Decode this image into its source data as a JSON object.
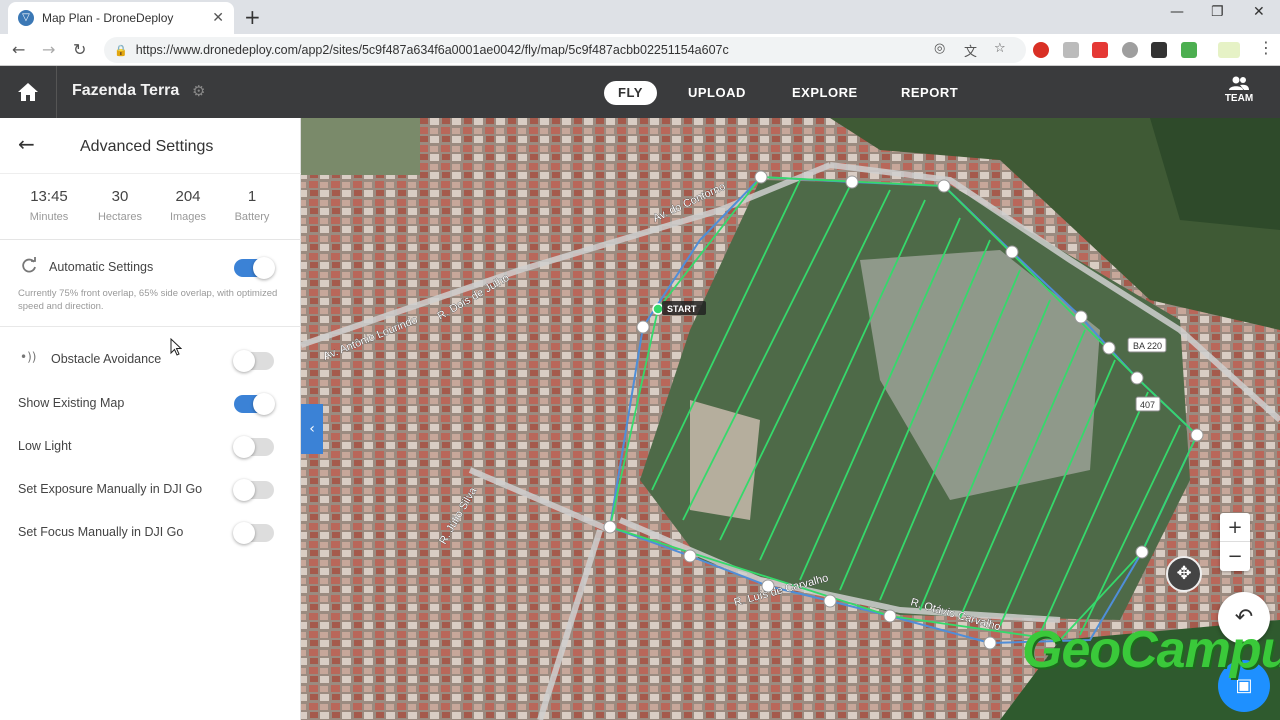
{
  "browser": {
    "tab_title": "Map Plan - DroneDeploy",
    "url": "https://www.dronedeploy.com/app2/sites/5c9f487a634f6a0001ae0042/fly/map/5c9f487acbb02251154a607c"
  },
  "header": {
    "site_name": "Fazenda Terra",
    "tabs": [
      {
        "label": "FLY",
        "active": true
      },
      {
        "label": "UPLOAD",
        "active": false
      },
      {
        "label": "EXPLORE",
        "active": false
      },
      {
        "label": "REPORT",
        "active": false
      }
    ],
    "team_label": "TEAM"
  },
  "panel": {
    "title": "Advanced Settings",
    "stats": [
      {
        "value": "13:45",
        "label": "Minutes"
      },
      {
        "value": "30",
        "label": "Hectares"
      },
      {
        "value": "204",
        "label": "Images"
      },
      {
        "value": "1",
        "label": "Battery"
      }
    ],
    "automatic": {
      "label": "Automatic Settings",
      "description": "Currently 75% front overlap, 65% side overlap, with optimized speed and direction.",
      "on": true
    },
    "settings": [
      {
        "label": "Obstacle Avoidance",
        "on": false
      },
      {
        "label": "Show Existing Map",
        "on": true
      },
      {
        "label": "Low Light",
        "on": false
      },
      {
        "label": "Set Exposure Manually in DJI Go",
        "on": false
      },
      {
        "label": "Set Focus Manually in DJI Go",
        "on": false
      }
    ]
  },
  "map": {
    "start_label": "START",
    "streets": [
      "Av. do Contorno",
      "R. Otávio Carvalho",
      "R. Júlio Silva",
      "Av. Antônio Lourindo",
      "R. Dois de Julho",
      "R. Luís de Carvalho",
      "BA 220",
      "407"
    ],
    "zoom_in": "+",
    "zoom_out": "−"
  },
  "watermark": "GeoCampus",
  "colors": {
    "accent": "#3b82d6",
    "header_bg": "#3a3b3d",
    "flight_lines": "#35d96b",
    "boundary": "#4f8ed8"
  }
}
